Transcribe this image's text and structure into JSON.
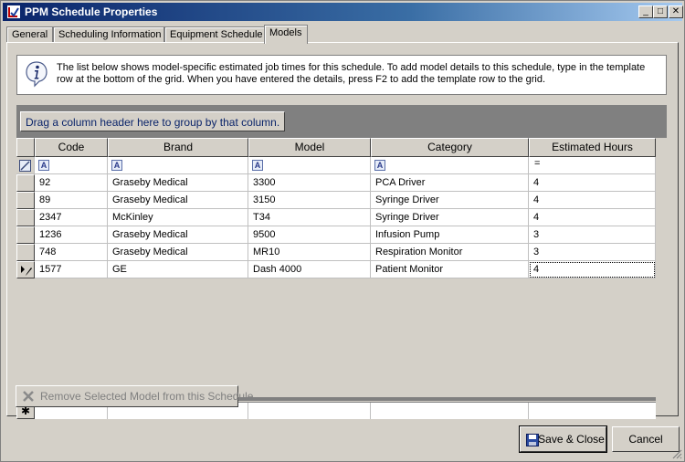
{
  "window": {
    "title": "PPM Schedule Properties",
    "controls": {
      "minimize": "_",
      "maximize": "□",
      "close": "✕"
    }
  },
  "tabs": [
    {
      "label": "General"
    },
    {
      "label": "Scheduling Information"
    },
    {
      "label": "Equipment Schedule"
    },
    {
      "label": "Models",
      "active": true
    }
  ],
  "info": {
    "icon": "info-icon",
    "text": "The list below shows model-specific estimated job times for this schedule. To add model details to this schedule, type in the template row at the bottom of the grid. When you have entered the details, press F2 to add the template row to the grid."
  },
  "grid": {
    "group_hint": "Drag a column header here to group by that column.",
    "columns": [
      "Code",
      "Brand",
      "Model",
      "Category",
      "Estimated Hours"
    ],
    "filter_glyphs": [
      "A",
      "A",
      "A",
      "A",
      "="
    ],
    "rows": [
      {
        "code": "92",
        "brand": "Graseby Medical",
        "model": "3300",
        "category": "PCA Driver",
        "hours": "4"
      },
      {
        "code": "89",
        "brand": "Graseby Medical",
        "model": "3150",
        "category": "Syringe Driver",
        "hours": "4"
      },
      {
        "code": "2347",
        "brand": "McKinley",
        "model": "T34",
        "category": "Syringe Driver",
        "hours": "4"
      },
      {
        "code": "1236",
        "brand": "Graseby Medical",
        "model": "9500",
        "category": "Infusion Pump",
        "hours": "3"
      },
      {
        "code": "748",
        "brand": "Graseby Medical",
        "model": "MR10",
        "category": "Respiration Monitor",
        "hours": "3"
      },
      {
        "code": "1577",
        "brand": "GE",
        "model": "Dash 4000",
        "category": "Patient Monitor",
        "hours": "4"
      }
    ],
    "new_row_glyph": "✱"
  },
  "buttons": {
    "remove": "Remove Selected Model from this Schedule",
    "save_close": "Save & Close",
    "cancel": "Cancel"
  },
  "colors": {
    "title_start": "#0a246a",
    "title_end": "#a6caf0",
    "face": "#d4d0c8",
    "group_area": "#808080",
    "hint_text": "#0a246a"
  }
}
